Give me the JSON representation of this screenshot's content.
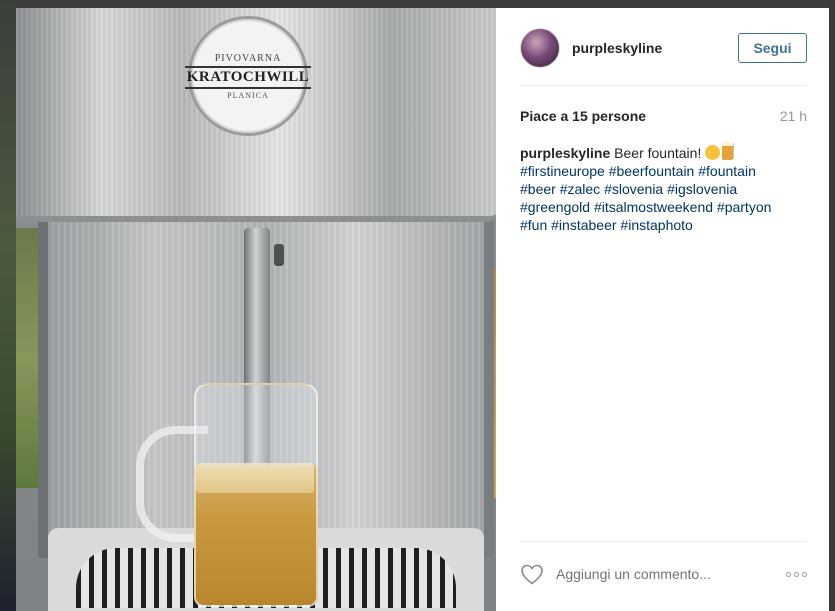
{
  "photo": {
    "logo_top": "PIVOVARNA",
    "logo_main": "KRATOCHWILL",
    "logo_sub": "PLANICA"
  },
  "post": {
    "username": "purpleskyline",
    "follow_label": "Segui",
    "likes": "Piace a 15 persone",
    "time_ago": "21 h",
    "caption_user": "purpleskyline",
    "caption_text": "Beer fountain!",
    "hashtags": [
      "#firstineurope",
      "#beerfountain",
      "#fountain",
      "#beer",
      "#zalec",
      "#slovenia",
      "#igslovenia",
      "#greengold",
      "#itsalmostweekend",
      "#partyon",
      "#fun",
      "#instabeer",
      "#instaphoto"
    ],
    "comment_placeholder": "Aggiungi un commento..."
  },
  "icons": {
    "like": "heart-icon",
    "more": "more-options-icon",
    "emoji1": "grinning-face-emoji",
    "emoji2": "beer-mug-emoji"
  }
}
